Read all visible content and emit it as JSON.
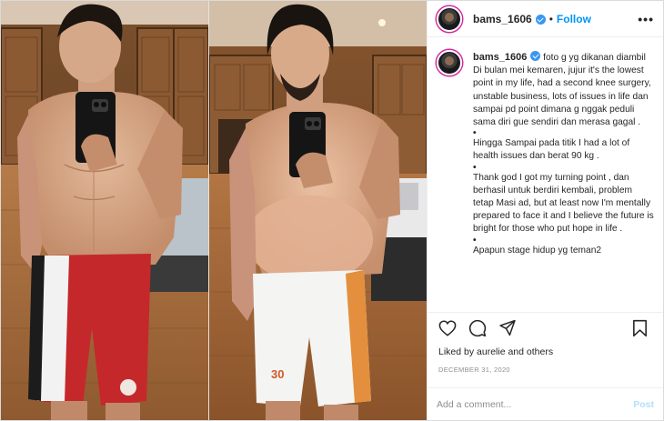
{
  "post": {
    "username": "bams_1606",
    "follow_label": "Follow",
    "separator": "•",
    "more_label": "•••"
  },
  "caption": {
    "username": "bams_1606",
    "paragraphs": [
      "foto g yg dikanan diambil Di bulan mei kemaren, jujur it's the lowest point in my life, had a second knee surgery, unstable business, lots of issues in life dan sampai pd point dimana g nggak peduli sama diri gue sendiri dan merasa gagal .",
      "•",
      "Hingga Sampai pada titik I had a lot of health issues dan berat 90 kg .",
      "•",
      "Thank god I got my turning point , dan berhasil untuk berdiri kembali, problem tetap Masi ad, but at least now I'm mentally prepared to face it and I believe the future is bright for those who put hope in life .",
      "•",
      "Apapun stage hidup yg teman2"
    ]
  },
  "actions": {
    "like_icon": "heart-icon",
    "comment_icon": "comment-icon",
    "share_icon": "share-icon",
    "save_icon": "bookmark-icon"
  },
  "likes_text": "Liked by aurelie and others",
  "date": "DECEMBER 31, 2020",
  "comment_box": {
    "placeholder": "Add a comment...",
    "post_label": "Post"
  },
  "colors": {
    "accent": "#0095f6",
    "verified": "#3897f0",
    "muted": "#8e8e8e",
    "post_disabled": "#b2dffc"
  }
}
